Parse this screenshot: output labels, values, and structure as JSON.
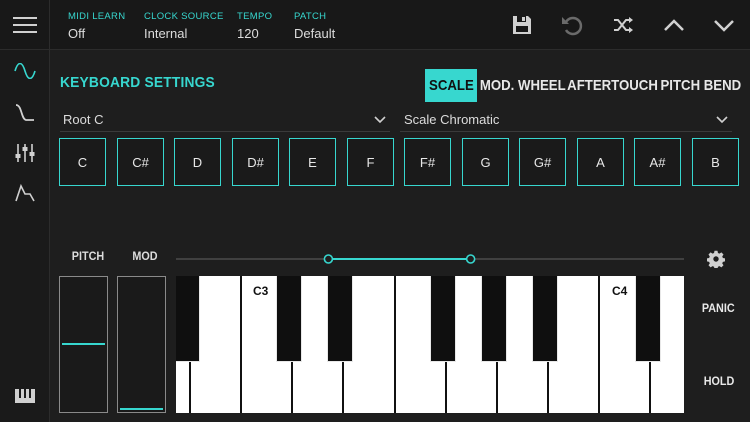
{
  "topbar": {
    "status": [
      {
        "label": "MIDI LEARN",
        "value": "Off"
      },
      {
        "label": "CLOCK SOURCE",
        "value": "Internal"
      },
      {
        "label": "TEMPO",
        "value": "120"
      },
      {
        "label": "PATCH",
        "value": "Default"
      }
    ],
    "icons": [
      "save-icon",
      "undo-icon",
      "shuffle-icon",
      "chevron-up-icon",
      "chevron-down-icon"
    ]
  },
  "sidebar": {
    "icons": [
      "sine-wave-icon",
      "envelope-curve-icon",
      "mixer-sliders-icon",
      "adsr-icon",
      "keyboard-icon"
    ]
  },
  "main": {
    "title": "KEYBOARD SETTINGS",
    "tabs": [
      {
        "label": "SCALE",
        "active": true
      },
      {
        "label": "MOD. WHEEL",
        "active": false
      },
      {
        "label": "AFTERTOUCH",
        "active": false
      },
      {
        "label": "PITCH BEND",
        "active": false
      }
    ],
    "root_select": "Root C",
    "scale_select": "Scale Chromatic",
    "notes": [
      "C",
      "C#",
      "D",
      "D#",
      "E",
      "F",
      "F#",
      "G",
      "G#",
      "A",
      "A#",
      "B"
    ]
  },
  "keyboard": {
    "pitch_label": "PITCH",
    "mod_label": "MOD",
    "pitch_value": 0.5,
    "mod_value": 0.0,
    "range_start": 0.3,
    "range_end": 0.58,
    "c3_label": "C3",
    "c4_label": "C4",
    "panic_label": "PANIC",
    "hold_label": "HOLD"
  },
  "colors": {
    "accent": "#37d7cf",
    "background": "#1e1e1e"
  }
}
